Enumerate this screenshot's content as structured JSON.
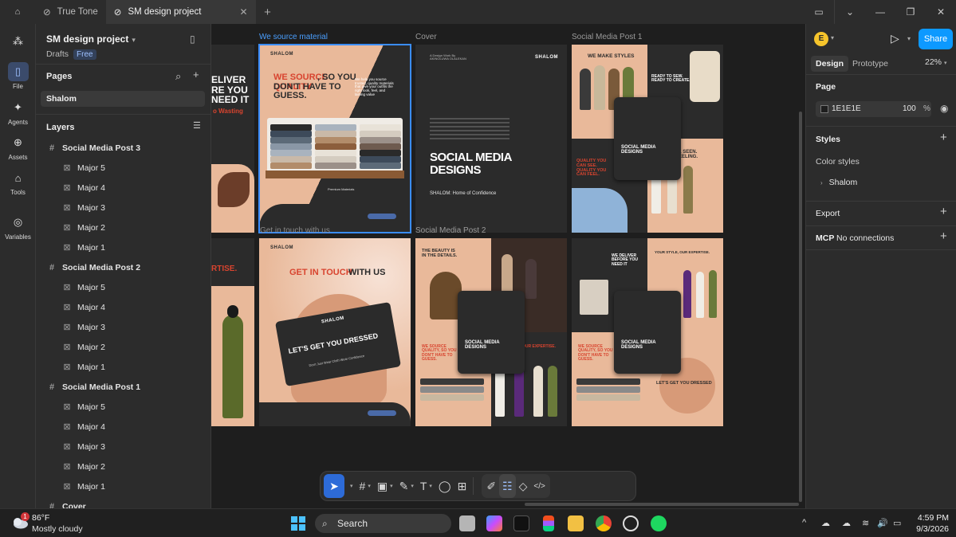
{
  "tabs": {
    "home": "⌂",
    "items": [
      {
        "label": "True Tone"
      },
      {
        "label": "SM design project",
        "close": "✕"
      }
    ],
    "add": "+"
  },
  "window_controls": {
    "layout": "▭",
    "chevron": "⌄",
    "minimize": "—",
    "restore": "❐",
    "close": "✕"
  },
  "rail": [
    {
      "icon": "file-icon",
      "glyph": "▯",
      "label": "File"
    },
    {
      "icon": "agents-icon",
      "glyph": "✦",
      "label": "Agents"
    },
    {
      "icon": "assets-icon",
      "glyph": "⊕",
      "label": "Assets"
    },
    {
      "icon": "tools-icon",
      "glyph": "⌂",
      "label": "Tools"
    },
    {
      "icon": "variables-icon",
      "glyph": "◎",
      "label": "Variables"
    }
  ],
  "project": {
    "name": "SM design project",
    "drafts": "Drafts",
    "plan": "Free"
  },
  "pages": {
    "title": "Pages",
    "current": "Shalom"
  },
  "layers": {
    "title": "Layers",
    "rows": [
      {
        "label": "Social Media Post 3",
        "type": "frame",
        "icon": "#"
      },
      {
        "label": "Major 5",
        "type": "child",
        "icon": "⊠"
      },
      {
        "label": "Major 4",
        "type": "child",
        "icon": "⊠"
      },
      {
        "label": "Major 3",
        "type": "child",
        "icon": "⊠"
      },
      {
        "label": "Major 2",
        "type": "child",
        "icon": "⊠"
      },
      {
        "label": "Major 1",
        "type": "child",
        "icon": "⊠"
      },
      {
        "label": "Social Media Post 2",
        "type": "frame",
        "icon": "#"
      },
      {
        "label": "Major 5",
        "type": "child",
        "icon": "⊠"
      },
      {
        "label": "Major 4",
        "type": "child",
        "icon": "⊠"
      },
      {
        "label": "Major 3",
        "type": "child",
        "icon": "⊠"
      },
      {
        "label": "Major 2",
        "type": "child",
        "icon": "⊠"
      },
      {
        "label": "Major 1",
        "type": "child",
        "icon": "⊠"
      },
      {
        "label": "Social Media Post 1",
        "type": "frame",
        "icon": "#"
      },
      {
        "label": "Major 5",
        "type": "child",
        "icon": "⊠"
      },
      {
        "label": "Major 4",
        "type": "child",
        "icon": "⊠"
      },
      {
        "label": "Major 3",
        "type": "child",
        "icon": "⊠"
      },
      {
        "label": "Major 2",
        "type": "child",
        "icon": "⊠"
      },
      {
        "label": "Major 1",
        "type": "child",
        "icon": "⊠"
      },
      {
        "label": "Cover",
        "type": "frame",
        "icon": "#"
      }
    ]
  },
  "canvas": {
    "labels": {
      "we_source": "We source material",
      "cover": "Cover",
      "post1": "Social Media Post 1",
      "post2": "Social Media Post 2"
    },
    "frames": {
      "left_top_text": "ELIVER\nRE YOU\nNEED IT",
      "left_top_sub": "o Wasting",
      "ws_headline_red": "WE SOURCE\nQUALITY",
      "ws_headline_rest": ", SO YOU\nDON'T HAVE TO\nGUESS.",
      "brand": "SHALOM",
      "ws_body": "We help you source trusted, quality materials that give your outfits the right look, feel, and lasting value",
      "ws_premium": "Premium Materials",
      "cover_title": "SOCIAL MEDIA\nDESIGNS",
      "cover_sub": "SHALOM: Home of Confidence",
      "cover_design": "A Design Work By\nAKINOLUWA OLALEKAN",
      "p1_headline": "WE MAKE STYLES",
      "p1_ready": "READY TO SEW.\nREADY TO CREATE.",
      "p1_quality": "QUALITY YOU\nCAN SEE.\nQUALITY YOU\nCAN FEEL.",
      "p1_seen": "L SEEN.\nEELING.",
      "p1_card": "SOCIAL MEDIA\nDESIGNS",
      "left_bot_text": "RTISE.",
      "git_red": "GET IN TOUCH",
      "git_rest": "WITH US",
      "card_brand": "SHALOM",
      "card_text": "LET'S GET YOU DRESSED",
      "card_sub": "Don't Just Wear Cloth Wear Confidence",
      "p2_beauty": "THE BEAUTY IS\nIN THE DETAILS.",
      "p2_card": "SOCIAL MEDIA\nDESIGNS",
      "p2_quality": "WE SOURCE\nQUALITY, SO YOU\nDON'T HAVE TO\nGUESS.",
      "p2_expertise": "OUR EXPERTISE.",
      "p3_deliver": "WE DELIVER\nBEFORE YOU\nNEED IT",
      "p3_style": "YOUR STYLE, OUR EXPERTISE.",
      "p3_card": "SOCIAL MEDIA\nDESIGNS",
      "p3_dressed": "LET'S GET YOU DRESSED"
    }
  },
  "toolbar": {
    "move": "➤",
    "frame": "#",
    "image": "▣",
    "pen": "✎",
    "text": "T",
    "comment": "◯",
    "actions": "⊞",
    "dev1": "✐",
    "dev2": "☷",
    "dev3": "◇",
    "dev4": "</>",
    "dropdown": "▾"
  },
  "help": "?",
  "right_panel": {
    "avatar": "E",
    "share": "Share",
    "play": "▷",
    "tabs": [
      "Design",
      "Prototype"
    ],
    "zoom": "22%",
    "page_section": "Page",
    "page_color": "1E1E1E",
    "page_opacity": "100",
    "pct": "%",
    "styles": "Styles",
    "color_styles": "Color styles",
    "color_style_item": "Shalom",
    "export": "Export",
    "mcp": "MCP",
    "mcp_status": "No connections",
    "plus": "+",
    "eye": "◉"
  },
  "taskbar": {
    "weather_badge": "1",
    "temp": "86°F",
    "condition": "Mostly cloudy",
    "search": "Search",
    "time": "4:59 PM",
    "date": "9/3/2026",
    "tray": [
      "^",
      "☁",
      "☁",
      "≋",
      "🔊",
      "▭"
    ]
  },
  "colors": {
    "accent": "#0d99ff",
    "selection": "#3a8dff",
    "canvas": "#1e1e1e",
    "panel": "#2c2c2c",
    "brand_red": "#d8442f",
    "cream": "#e9b99a"
  }
}
